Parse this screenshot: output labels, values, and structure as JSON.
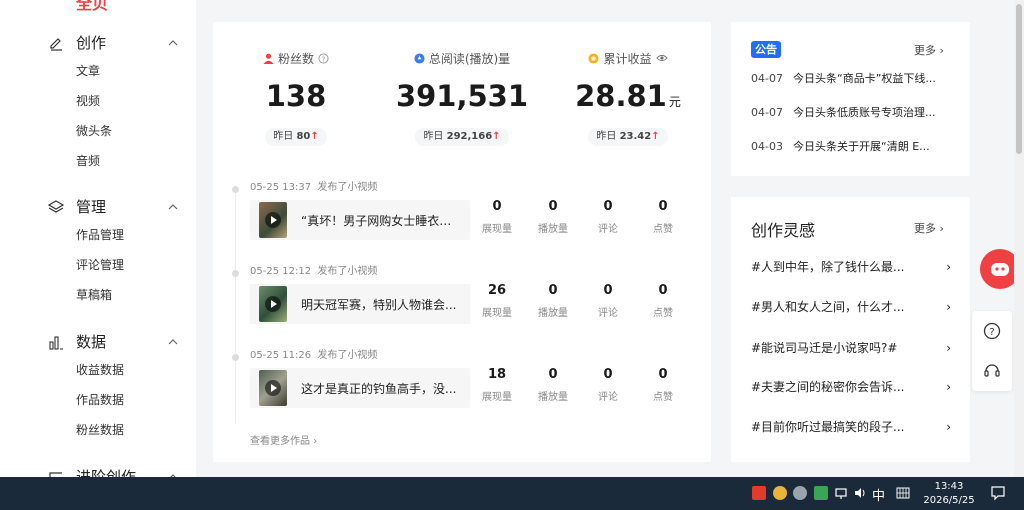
{
  "sidebar": {
    "top_cut_label": "全贝",
    "groups": [
      {
        "label": "创作",
        "icon": "pencil-icon",
        "items": [
          "文章",
          "视频",
          "微头条",
          "音频"
        ]
      },
      {
        "label": "管理",
        "icon": "layers-icon",
        "items": [
          "作品管理",
          "评论管理",
          "草稿箱"
        ]
      },
      {
        "label": "数据",
        "icon": "bar-chart-icon",
        "items": [
          "收益数据",
          "作品数据",
          "粉丝数据"
        ]
      },
      {
        "label": "进阶创作",
        "icon": "advanced-icon",
        "items": []
      }
    ]
  },
  "stats": [
    {
      "title": "粉丝数",
      "icon": "fans-icon",
      "suffix_icon": "help-icon",
      "value": "138",
      "unit": "",
      "yesterday_label": "昨日",
      "yesterday_value": "80",
      "trend": "↑"
    },
    {
      "title": "总阅读(播放)量",
      "icon": "read-icon",
      "suffix_icon": "",
      "value": "391,531",
      "unit": "",
      "yesterday_label": "昨日",
      "yesterday_value": "292,166",
      "trend": "↑"
    },
    {
      "title": "累计收益",
      "icon": "coin-icon",
      "suffix_icon": "eye-icon",
      "value": "28.81",
      "unit": "元",
      "yesterday_label": "昨日",
      "yesterday_value": "23.42",
      "trend": "↑"
    }
  ],
  "feed": {
    "metric_labels": [
      "展现量",
      "播放量",
      "评论",
      "点赞"
    ],
    "items": [
      {
        "time": "05-25 13:37",
        "action": "发布了小视频",
        "title": "“真坏！男子网购女士睡衣当...",
        "metrics": [
          "0",
          "0",
          "0",
          "0"
        ]
      },
      {
        "time": "05-25 12:12",
        "action": "发布了小视频",
        "title": "明天冠军赛，特别人物谁会...",
        "metrics": [
          "26",
          "0",
          "0",
          "0"
        ]
      },
      {
        "time": "05-25 11:26",
        "action": "发布了小视频",
        "title": "这才是真正的钓鱼高手，没...",
        "metrics": [
          "18",
          "0",
          "0",
          "0"
        ]
      }
    ],
    "view_more": "查看更多作品"
  },
  "notice": {
    "badge": "公告",
    "more": "更多",
    "items": [
      {
        "date": "04-07",
        "title": "今日头条“商品卡”权益下线..."
      },
      {
        "date": "04-07",
        "title": "今日头条低质账号专项治理..."
      },
      {
        "date": "04-03",
        "title": "今日头条关于开展“清朗 E..."
      }
    ]
  },
  "inspiration": {
    "title": "创作灵感",
    "more": "更多",
    "items": [
      "#人到中年，除了钱什么最...",
      "#男人和女人之间，什么才...",
      "#能说司马迁是小说家吗?#",
      "#夫妻之间的秘密你会告诉...",
      "#目前你听过最搞笑的段子..."
    ]
  },
  "taskbar": {
    "ime": "中",
    "time": "13:43",
    "date": "2026/5/25"
  },
  "colors": {
    "accent": "#f04142",
    "blue": "#1e6eff"
  }
}
